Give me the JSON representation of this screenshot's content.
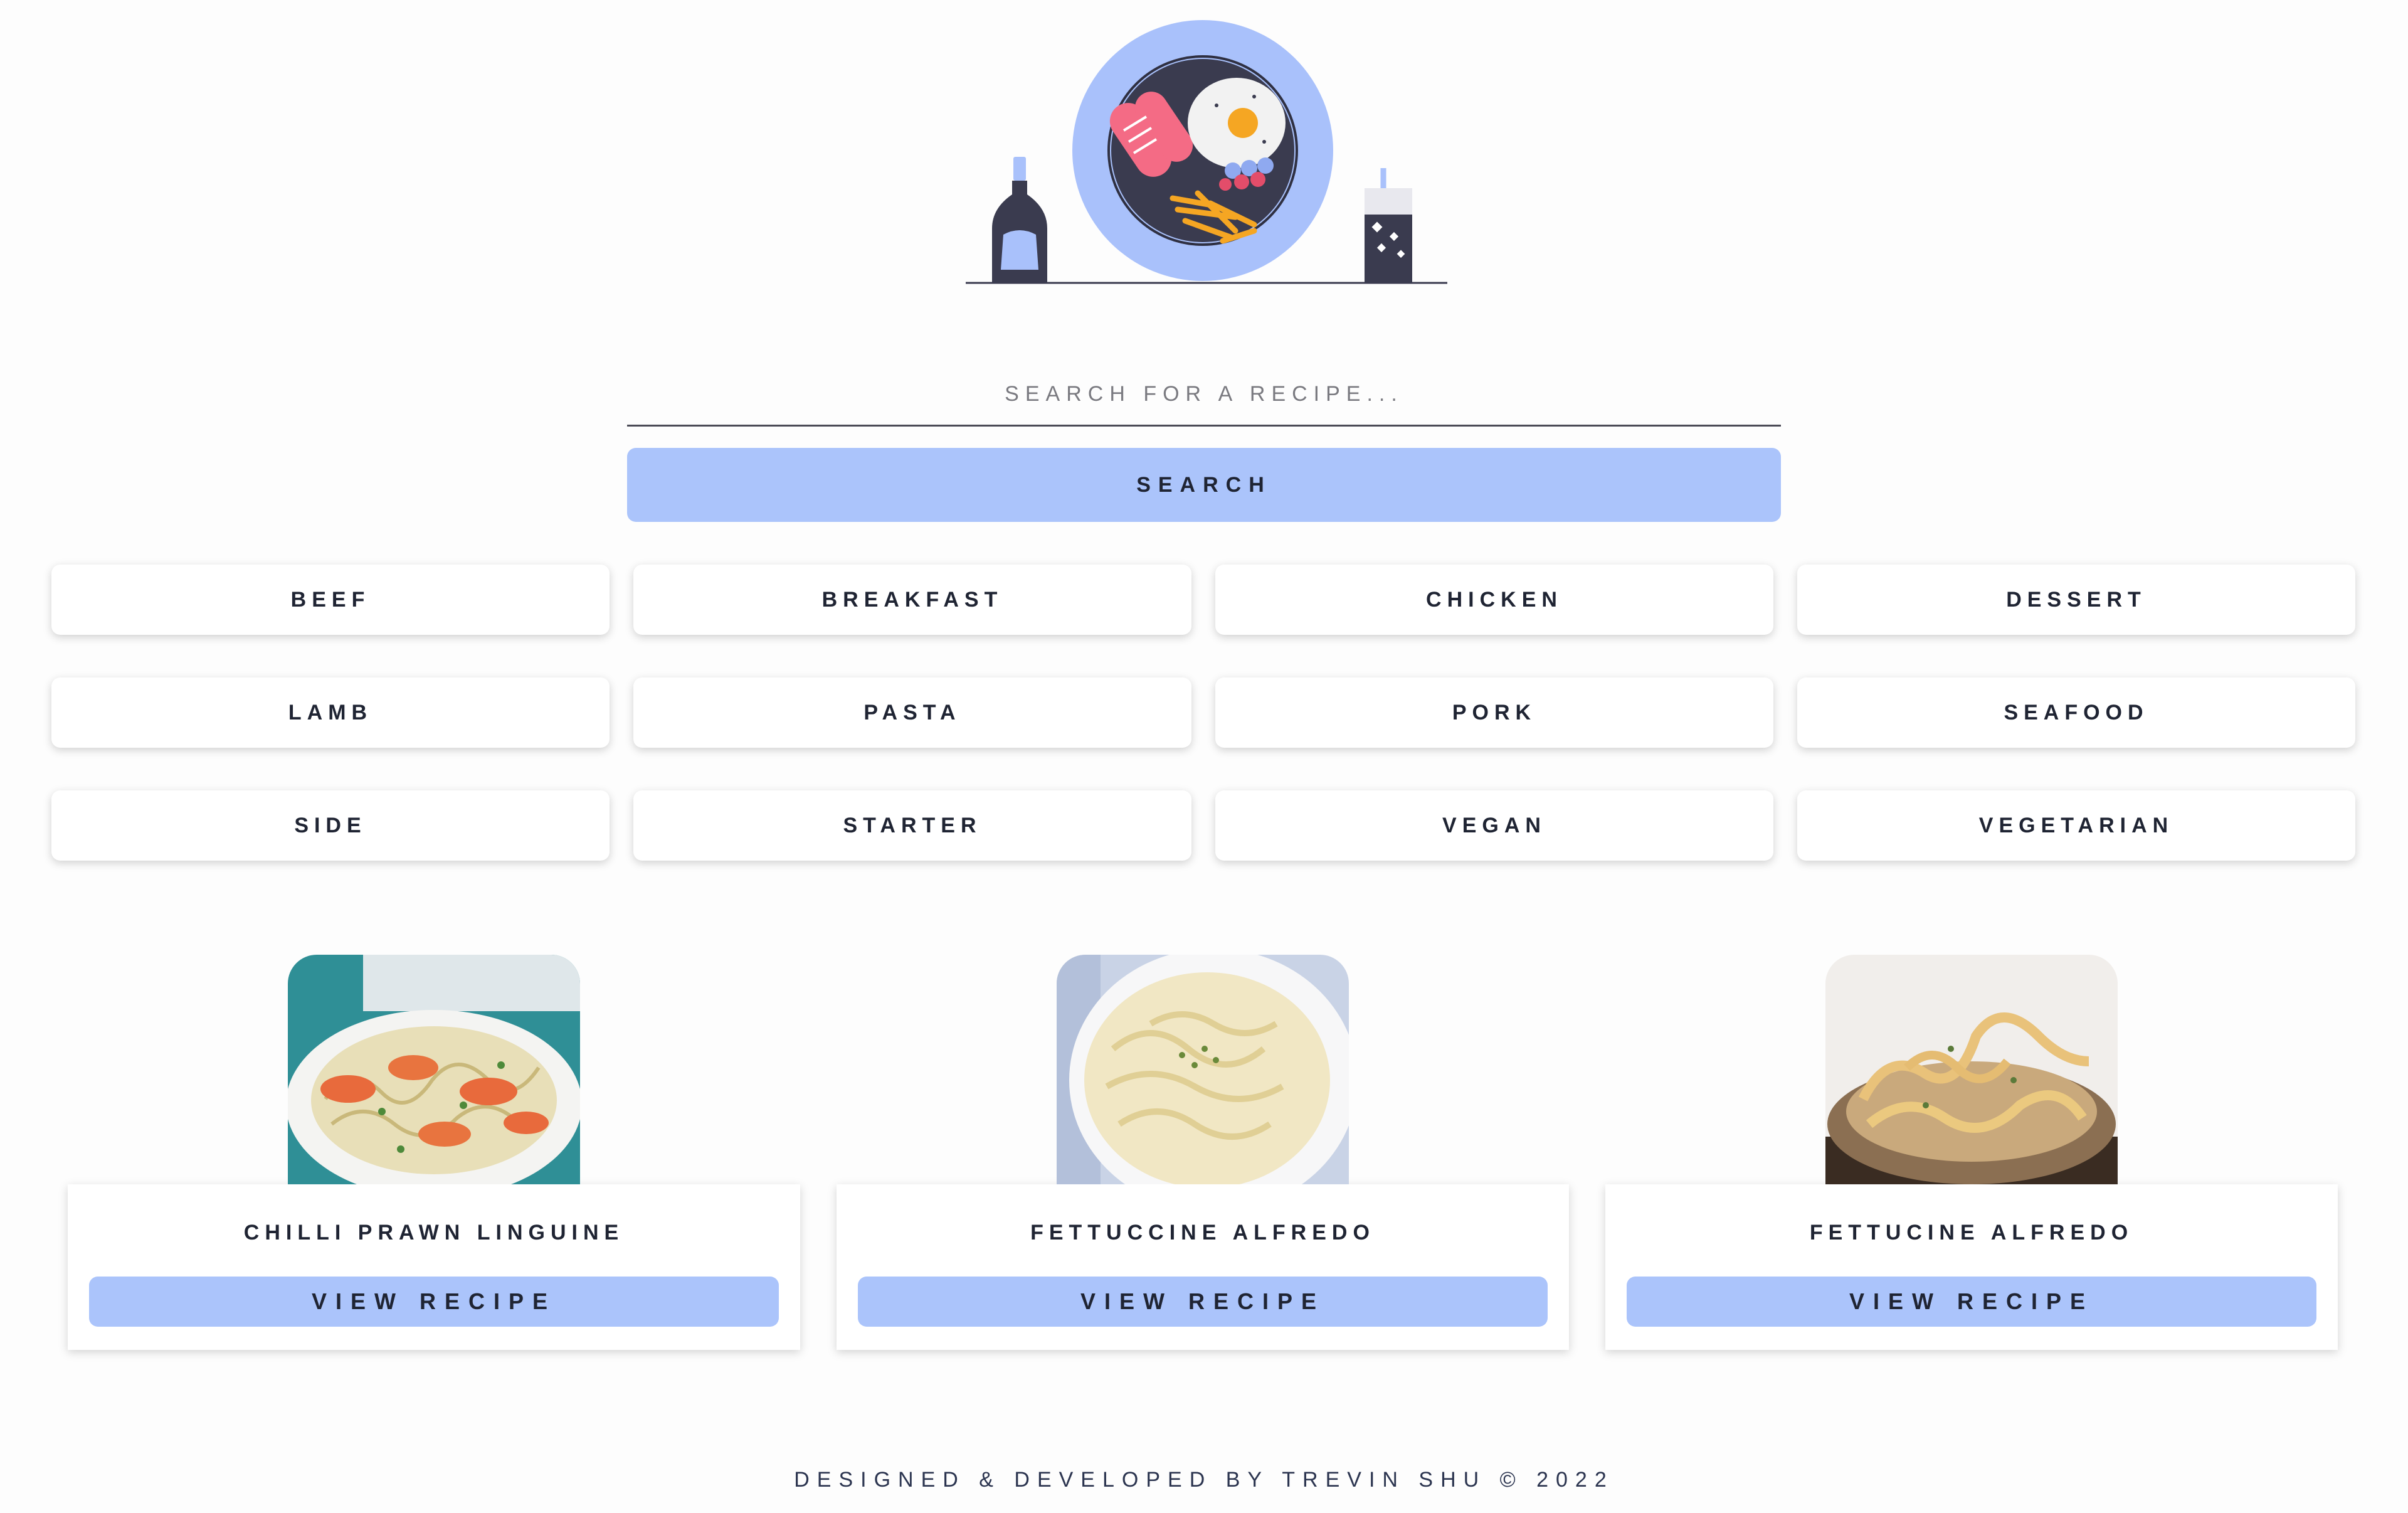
{
  "colors": {
    "accent": "#abc4fb",
    "text": "#1f2433",
    "background": "#fdfdfd",
    "card": "#ffffff"
  },
  "hero": {
    "illustration": "breakfast-plate-illustration"
  },
  "search": {
    "placeholder": "SEARCH FOR A RECIPE...",
    "value": "",
    "button_label": "SEARCH"
  },
  "categories": [
    "BEEF",
    "BREAKFAST",
    "CHICKEN",
    "DESSERT",
    "LAMB",
    "PASTA",
    "PORK",
    "SEAFOOD",
    "SIDE",
    "STARTER",
    "VEGAN",
    "VEGETARIAN"
  ],
  "recipes": [
    {
      "title": "CHILLI PRAWN LINGUINE",
      "button_label": "VIEW RECIPE",
      "photo": "prawn-linguine-photo"
    },
    {
      "title": "FETTUCCINE ALFREDO",
      "button_label": "VIEW RECIPE",
      "photo": "fettuccine-alfredo-photo"
    },
    {
      "title": "FETTUCINE ALFREDO",
      "button_label": "VIEW RECIPE",
      "photo": "fettucine-alfredo-photo"
    }
  ],
  "footer": {
    "text": "DESIGNED & DEVELOPED BY TREVIN SHU © 2022"
  }
}
